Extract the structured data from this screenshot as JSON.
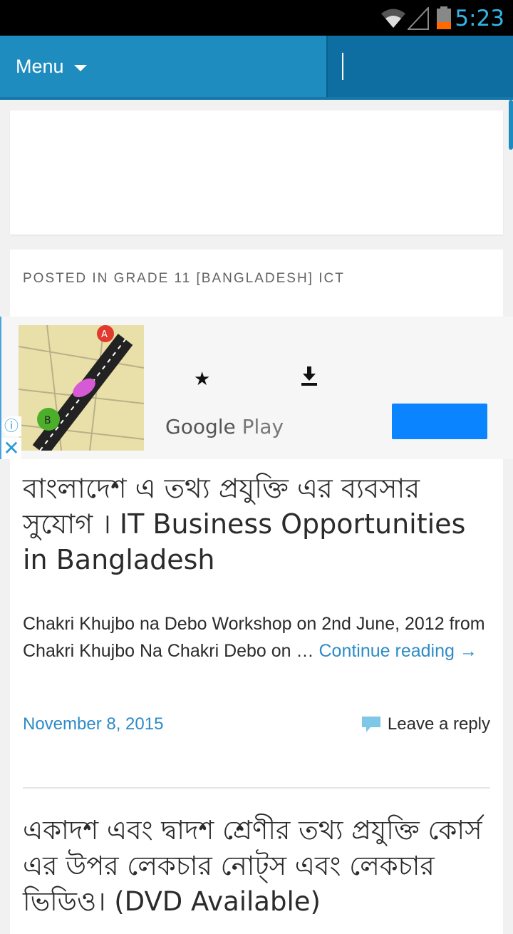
{
  "status_bar": {
    "time": "5:23",
    "icons": [
      "wifi-icon",
      "signal-icon",
      "battery-icon"
    ]
  },
  "header": {
    "menu_label": "Menu",
    "search_value": ""
  },
  "post": {
    "category_line": "POSTED IN GRADE 11 [BANGLADESH] ICT",
    "title": "বাংলাদেশ এ তথ্য প্রযুক্তি এর ব্যবসার সুযোগ । IT Business Opportunities in Bangladesh",
    "excerpt": "Chakri Khujbo na Debo Workshop on 2nd June, 2012 from Chakri Khujbo Na Chakri Debo on … ",
    "continue_label": "Continue reading →",
    "date": "November 8, 2015",
    "reply_label": "Leave a reply"
  },
  "ad": {
    "store_name_google": "Google",
    "store_name_play": "Play",
    "icons": [
      "star-icon",
      "download-icon",
      "info-icon",
      "close-icon"
    ],
    "cta_color": "#0a84ff"
  },
  "next_post": {
    "title": "একাদশ এবং দ্বাদশ শ্রেণীর তথ্য প্রযুক্তি কোর্স এর উপর লেকচার নোট্স এবং লেকচার ভিডিও। (DVD Available)"
  },
  "colors": {
    "header": "#1e8cbe",
    "search": "#0e6ea1",
    "link": "#2e8bc7",
    "status_accent": "#33b5e5"
  }
}
